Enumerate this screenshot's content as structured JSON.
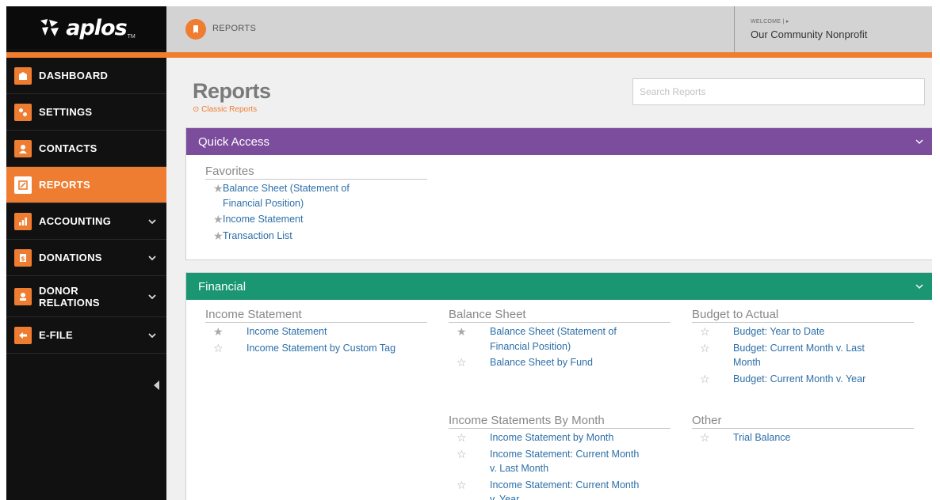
{
  "app": {
    "logo_text": "aplos",
    "logo_tm": "TM",
    "accent": "#ef7d31"
  },
  "topbar": {
    "crumb": "REPORTS",
    "welcome": "WELCOME | ▸",
    "org": "Our Community Nonprofit"
  },
  "sidebar": {
    "items": [
      {
        "label": "DASHBOARD",
        "icon": "dashboard-icon"
      },
      {
        "label": "SETTINGS",
        "icon": "settings-icon"
      },
      {
        "label": "CONTACTS",
        "icon": "contacts-icon"
      },
      {
        "label": "REPORTS",
        "icon": "reports-icon",
        "active": true
      },
      {
        "label": "ACCOUNTING",
        "icon": "accounting-icon",
        "expandable": true
      },
      {
        "label": "DONATIONS",
        "icon": "donations-icon",
        "expandable": true
      },
      {
        "label": "DONOR",
        "label2": "RELATIONS",
        "icon": "donor-relations-icon",
        "expandable": true
      },
      {
        "label": "E-FILE",
        "icon": "efile-icon",
        "expandable": true
      }
    ]
  },
  "main": {
    "title": "Reports",
    "classic_link": "⊙ Classic Reports",
    "search_placeholder": "Search Reports",
    "quick_access": {
      "title": "Quick Access",
      "color": "#7c4d9c",
      "favorites_title": "Favorites",
      "favorites": [
        {
          "label": "Balance Sheet (Statement of Financial Position)",
          "starred": true
        },
        {
          "label": "Income Statement",
          "starred": true
        },
        {
          "label": "Transaction List",
          "starred": true
        }
      ]
    },
    "financial": {
      "title": "Financial",
      "color": "#1b9672",
      "groups": {
        "income_statement": {
          "title": "Income Statement",
          "reports": [
            {
              "label": "Income Statement",
              "starred": true
            },
            {
              "label": "Income Statement by Custom Tag",
              "starred": false
            }
          ]
        },
        "balance_sheet": {
          "title": "Balance Sheet",
          "reports": [
            {
              "label": "Balance Sheet (Statement of Financial Position)",
              "starred": true
            },
            {
              "label": "Balance Sheet by Fund",
              "starred": false
            }
          ]
        },
        "budget_to_actual": {
          "title": "Budget to Actual",
          "reports": [
            {
              "label": "Budget: Year to Date",
              "starred": false
            },
            {
              "label": "Budget: Current Month v. Last Month",
              "starred": false
            },
            {
              "label": "Budget: Current Month v. Year",
              "starred": false
            }
          ]
        },
        "by_month": {
          "title": "Income Statements By Month",
          "reports": [
            {
              "label": "Income Statement by Month",
              "starred": false
            },
            {
              "label": "Income Statement: Current Month v. Last Month",
              "starred": false
            },
            {
              "label": "Income Statement: Current Month v. Year",
              "starred": false
            }
          ]
        },
        "other": {
          "title": "Other",
          "reports": [
            {
              "label": "Trial Balance",
              "starred": false
            }
          ]
        }
      }
    }
  }
}
